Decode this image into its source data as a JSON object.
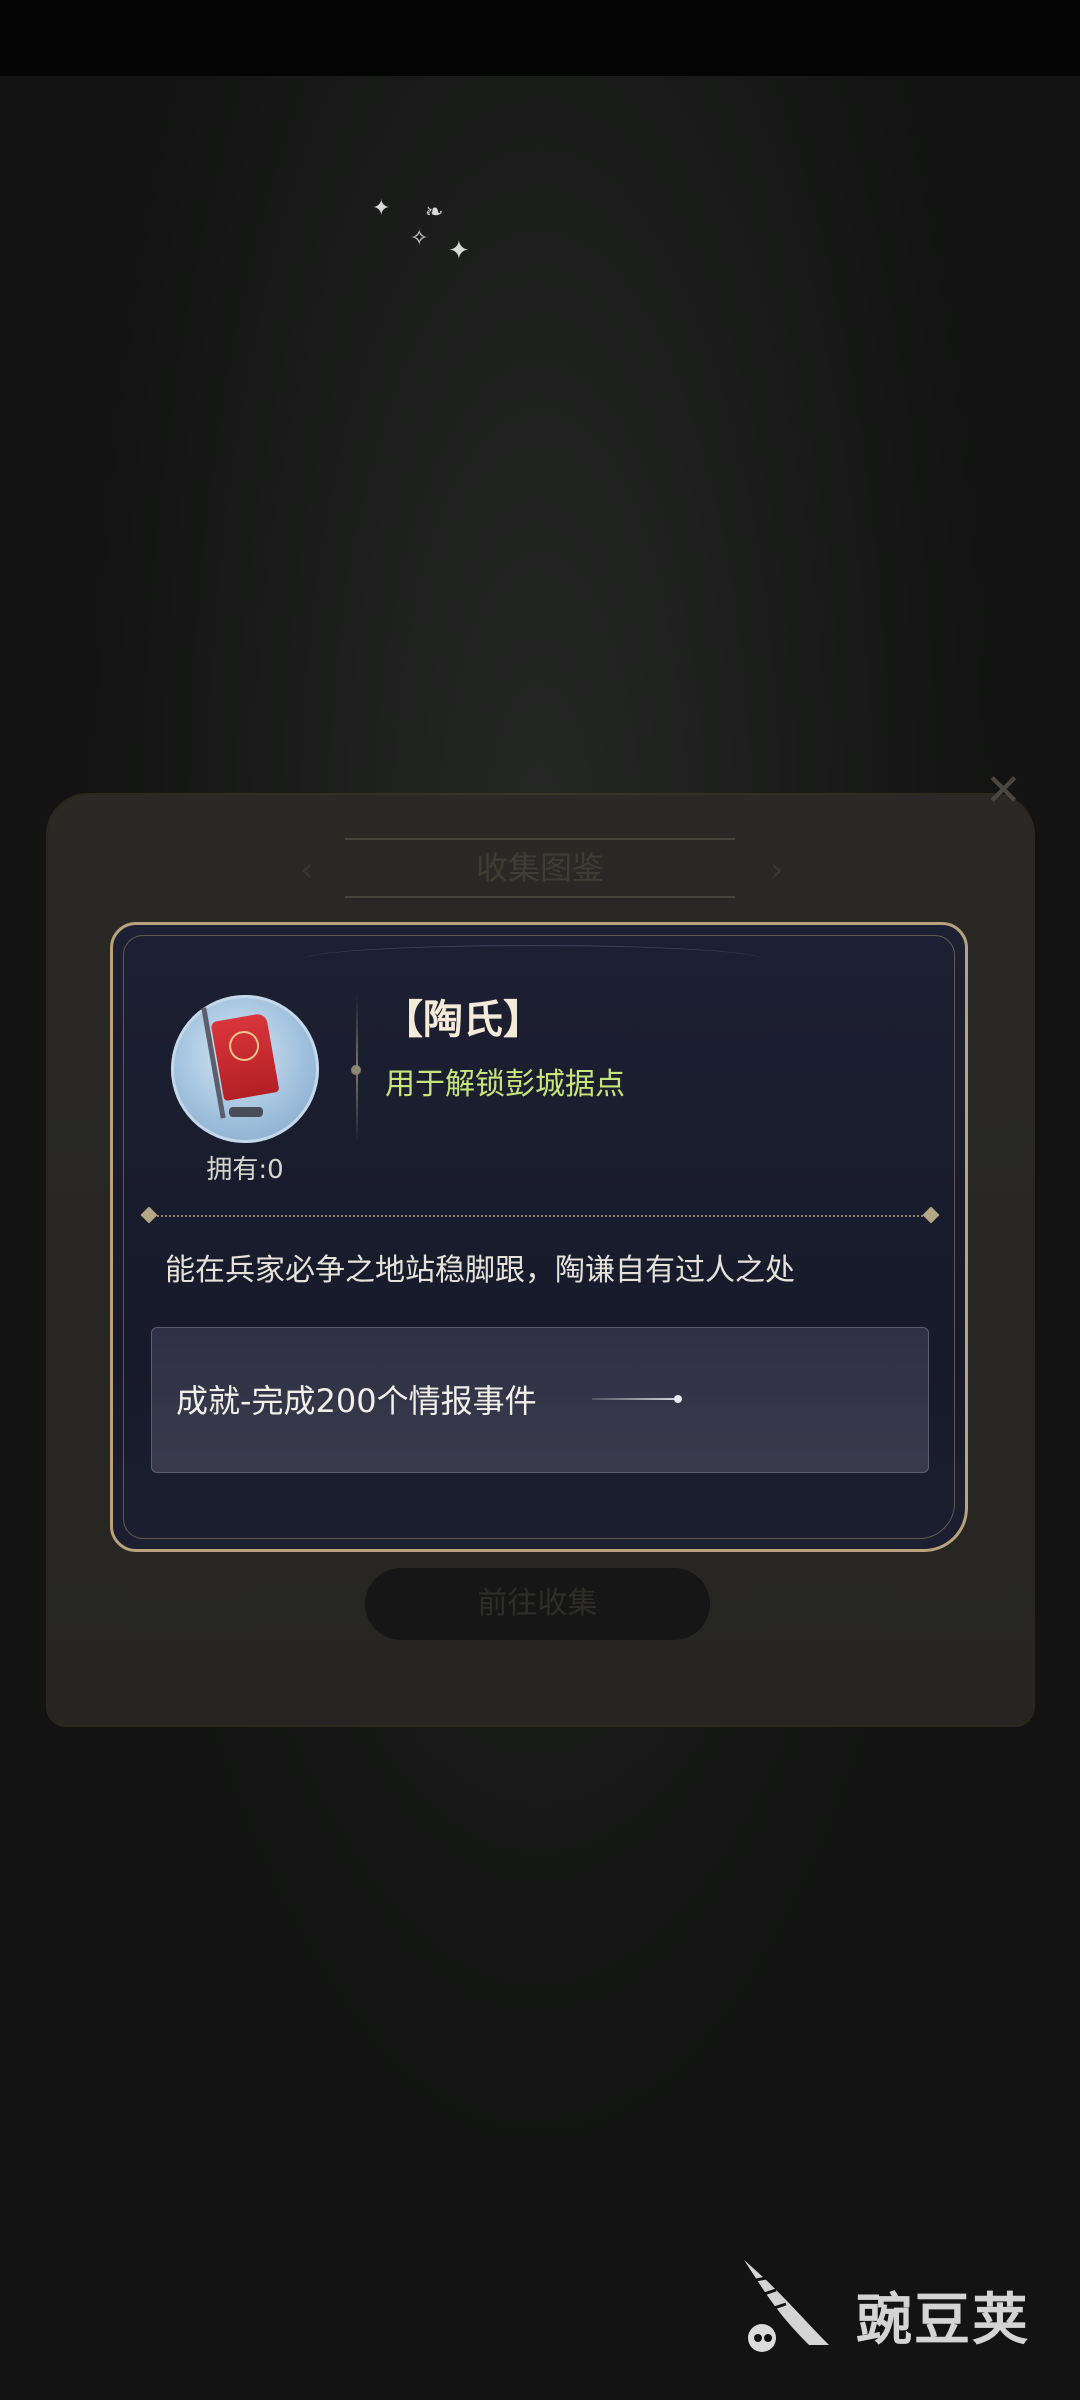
{
  "background_panel": {
    "title": "收集图鉴",
    "button_label": "前往收集",
    "close_icon": "close-icon"
  },
  "dialog": {
    "item_name": "【陶氏】",
    "item_use": "用于解锁彭城据点",
    "owned_text": "拥有:0",
    "description": "能在兵家必争之地站稳脚跟，陶谦自有过人之处",
    "source": "成就-完成200个情报事件",
    "accent_color": "#b9a27c",
    "use_text_color": "#c6e57a",
    "item_icon": "red-banner-icon"
  },
  "watermark": {
    "text": "豌豆荚",
    "logo_icon": "wandoujia-logo-icon"
  }
}
